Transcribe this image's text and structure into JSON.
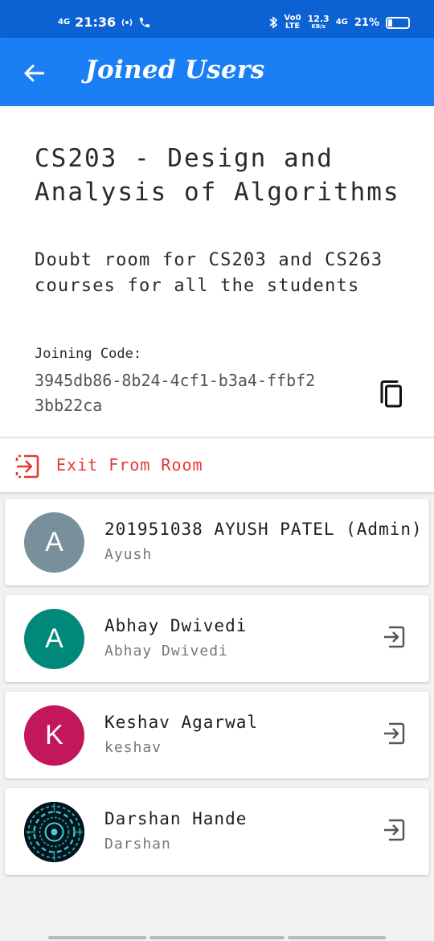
{
  "status_bar": {
    "network_left": "4G",
    "time": "21:36",
    "volte_top": "Vo0",
    "volte_bottom": "LTE",
    "speed_top": "12.3",
    "speed_bottom": "KB/s",
    "network_right": "4G",
    "battery_text": "21%",
    "battery_level": 0.21
  },
  "app_bar": {
    "title": "Joined Users"
  },
  "room": {
    "title": "CS203 - Design and Analysis of Algorithms",
    "description": "Doubt room for CS203 and CS263 courses for all the students",
    "code_label": "Joining Code:",
    "code_value": "3945db86-8b24-4cf1-b3a4-ffbf23bb22ca"
  },
  "exit": {
    "label": "Exit From Room",
    "color": "#e53935"
  },
  "users": [
    {
      "name": "201951038 AYUSH PATEL (Admin)",
      "username": "Ayush",
      "initial": "A",
      "avatar_color": "#78909c",
      "removable": false
    },
    {
      "name": "Abhay Dwivedi",
      "username": "Abhay Dwivedi",
      "initial": "A",
      "avatar_color": "#00897b",
      "removable": true
    },
    {
      "name": "Keshav Agarwal",
      "username": "keshav",
      "initial": "K",
      "avatar_color": "#c2185b",
      "removable": true
    },
    {
      "name": "Darshan Hande",
      "username": "Darshan",
      "initial": "",
      "avatar_color": "#0a1a24",
      "removable": true
    }
  ],
  "colors": {
    "status_bar": "#0d62d3",
    "app_bar": "#1a7ff5"
  }
}
